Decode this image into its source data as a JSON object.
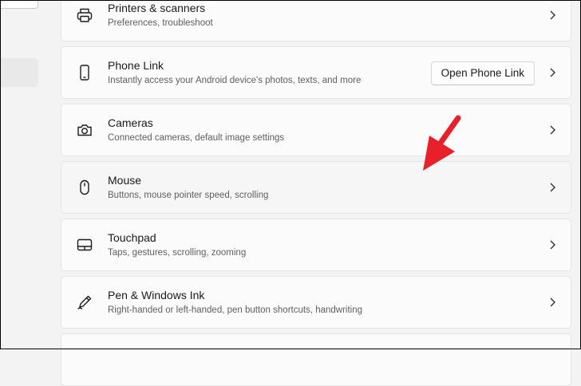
{
  "settings": {
    "items": [
      {
        "title": "Printers & scanners",
        "description": "Preferences, troubleshoot",
        "icon": "printer-icon"
      },
      {
        "title": "Phone Link",
        "description": "Instantly access your Android device's photos, texts, and more",
        "icon": "phone-icon",
        "action_label": "Open Phone Link"
      },
      {
        "title": "Cameras",
        "description": "Connected cameras, default image settings",
        "icon": "camera-icon"
      },
      {
        "title": "Mouse",
        "description": "Buttons, mouse pointer speed, scrolling",
        "icon": "mouse-icon",
        "hovered": true
      },
      {
        "title": "Touchpad",
        "description": "Taps, gestures, scrolling, zooming",
        "icon": "touchpad-icon"
      },
      {
        "title": "Pen & Windows Ink",
        "description": "Right-handed or left-handed, pen button shortcuts, handwriting",
        "icon": "pen-icon"
      }
    ]
  },
  "colors": {
    "background": "#f3f3f3",
    "card": "#fbfbfb",
    "card_hover": "#f6f6f6",
    "annotation_arrow": "#e8202a"
  }
}
